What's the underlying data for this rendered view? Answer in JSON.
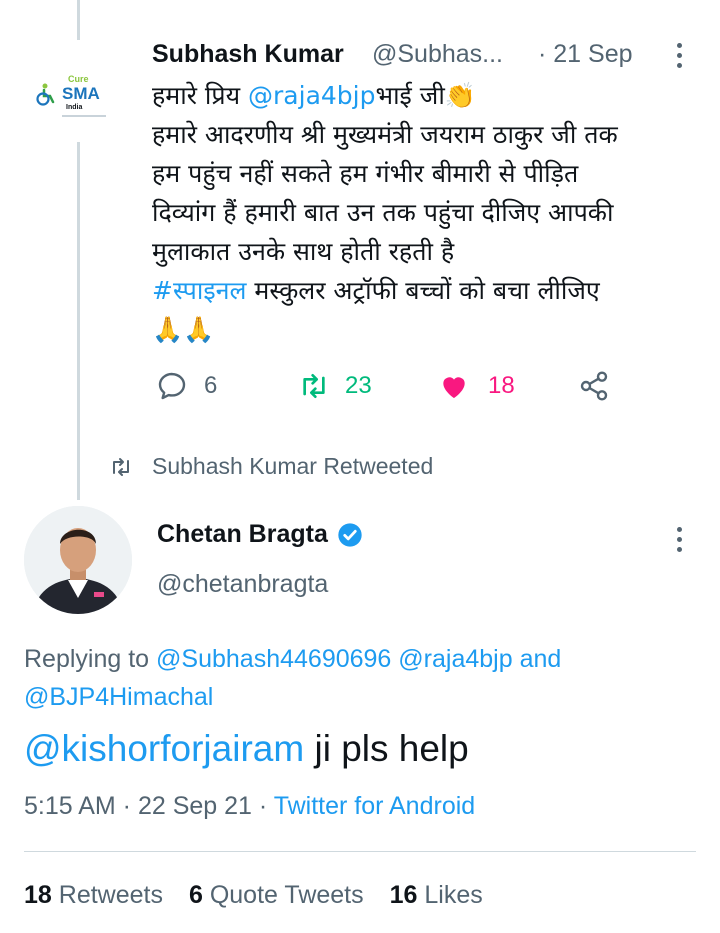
{
  "prev_tweet": {
    "avatar_logo": {
      "line1": "Cure",
      "line2": "SMA",
      "line3": "India"
    },
    "author_name": "Subhash Kumar",
    "handle": "@Subhas...",
    "date": "· 21 Sep",
    "text": {
      "line1_prefix": "हमारे प्रिय ",
      "line1_mention": "@raja4bjp",
      "line1_suffix": "भाई जी",
      "clap_emoji": "👏",
      "line2": "हमारे आदरणीय श्री मुख्यमंत्री जयराम ठाकुर जी तक",
      "line3": "हम पहुंच नहीं सकते हम गंभीर बीमारी से पीड़ित",
      "line4": "दिव्यांग हैं हमारी बात उन तक पहुंचा दीजिए आपकी",
      "line5": "मुलाकात उनके साथ होती रहती है",
      "hashtag": "#स्पाइनल",
      "line6_rest": " मस्कुलर अट्रॉफी बच्चों को बचा लीजिए",
      "pray_emoji": "🙏🙏"
    },
    "actions": {
      "reply_count": "6",
      "retweet_count": "23",
      "like_count": "18"
    },
    "colors": {
      "retweet": "#00ba7c",
      "like": "#f91880"
    }
  },
  "retweeted_label": "Subhash Kumar Retweeted",
  "main_tweet": {
    "author_name": "Chetan Bragta",
    "handle": "@chetanbragta",
    "replying_prefix": "Replying to ",
    "replying_mentions": "@Subhash44690696 @raja4bjp",
    "replying_and": " and",
    "replying_last": "@BJP4Himachal",
    "body_mention": "@kishorforjairam",
    "body_rest": " ji pls help",
    "time": "5:15 AM · 22 Sep 21 · ",
    "source": "Twitter for Android"
  },
  "stats": {
    "retweets_count": "18",
    "retweets_label": " Retweets",
    "quote_count": "6",
    "quote_label": " Quote Tweets",
    "likes_count": "16",
    "likes_label": " Likes"
  },
  "accent_color": "#1d9bf0"
}
